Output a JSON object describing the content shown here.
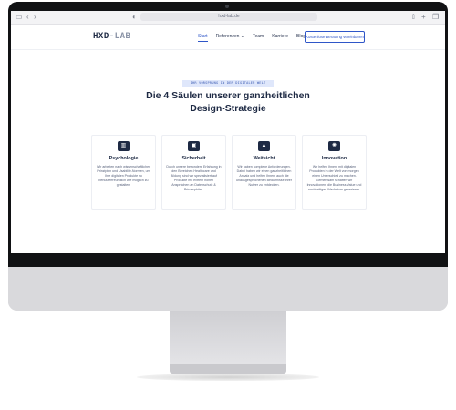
{
  "browser": {
    "url": "hxd-lab.de"
  },
  "site": {
    "logo_main": "HXD",
    "logo_suffix": "-LAB",
    "nav": [
      {
        "label": "Start"
      },
      {
        "label": "Referenzen ⌄"
      },
      {
        "label": "Team"
      },
      {
        "label": "Karriere"
      },
      {
        "label": "Blog"
      }
    ],
    "cta_label": "Kostenlose Beratung vereinbaren"
  },
  "hero": {
    "tagline": "IHR VORSPRUNG IN DER DIGITALEN WELT",
    "heading_line1": "Die 4 Säulen unserer ganzheitlichen",
    "heading_line2": "Design-Strategie"
  },
  "cards": [
    {
      "icon": "book-icon",
      "title": "Psychologie",
      "text": "Wir arbeiten nach wissenschaftlichen Prinzipien und Usability-Normen, um Ihre digitalen Produkte so benutzerfreundlich wie möglich zu gestalten."
    },
    {
      "icon": "lock-icon",
      "title": "Sicherheit",
      "text": "Durch unsere besondere Erfahrung in den Bereichen Healthcare und Bildung sind wir spezialisiert auf Produkte mit extrem hohen Ansprüchen an Datenschutz & Privatsphäre."
    },
    {
      "icon": "lighthouse-icon",
      "title": "Weitsicht",
      "text": "Wir haben komplexe Anforderungen. Dabei haben wir einen ganzheitlichen Ansatz und helfen Ihnen, auch die unausgesprochenen Bedürfnisse Ihrer Nutzer zu entdecken."
    },
    {
      "icon": "lightbulb-icon",
      "title": "Innovation",
      "text": "Wir helfen Ihnen, mit digitalen Produkten in der Welt von morgen einen Unterschied zu machen. Gemeinsam schaffen wir Innovationen, die Business Value und nachhaltiges Wachstum generieren."
    }
  ]
}
